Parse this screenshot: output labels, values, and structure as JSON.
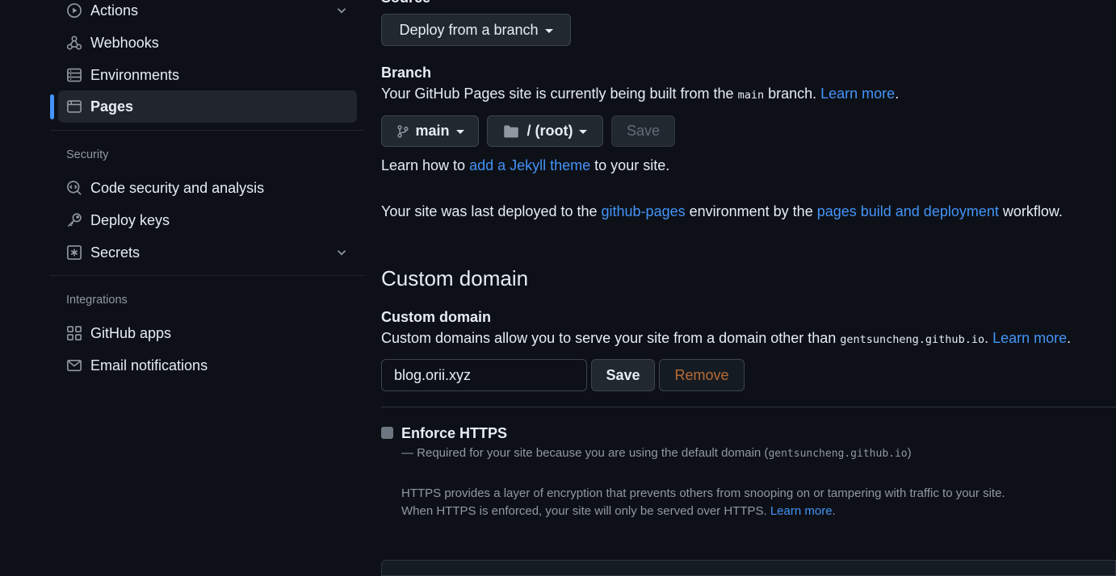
{
  "sidebar": {
    "items_top": [
      {
        "label": "Actions",
        "icon": "play-icon",
        "expandable": true
      },
      {
        "label": "Webhooks",
        "icon": "webhook-icon",
        "expandable": false
      },
      {
        "label": "Environments",
        "icon": "server-icon",
        "expandable": false
      },
      {
        "label": "Pages",
        "icon": "browser-icon",
        "expandable": false,
        "active": true
      }
    ],
    "security_heading": "Security",
    "security_items": [
      {
        "label": "Code security and analysis",
        "icon": "codescan-icon"
      },
      {
        "label": "Deploy keys",
        "icon": "key-icon"
      },
      {
        "label": "Secrets",
        "icon": "key-asterisk-icon",
        "expandable": true
      }
    ],
    "integrations_heading": "Integrations",
    "integrations_items": [
      {
        "label": "GitHub apps",
        "icon": "apps-icon"
      },
      {
        "label": "Email notifications",
        "icon": "mail-icon"
      }
    ]
  },
  "source": {
    "heading": "Source",
    "dropdown_label": "Deploy from a branch"
  },
  "branch": {
    "heading": "Branch",
    "desc_prefix": "Your GitHub Pages site is currently being built from the ",
    "desc_code": "main",
    "desc_suffix": " branch. ",
    "learn_more": "Learn more",
    "period": ".",
    "branch_button": "main",
    "folder_button": "/ (root)",
    "save_button": "Save"
  },
  "jekyll": {
    "prefix": "Learn how to ",
    "link": "add a Jekyll theme",
    "suffix": " to your site."
  },
  "deploy_info": {
    "prefix": "Your site was last deployed to the ",
    "env_link": "github-pages",
    "middle": " environment by the ",
    "workflow_link": "pages build and deployment",
    "suffix": " workflow."
  },
  "custom_domain": {
    "section_title": "Custom domain",
    "label": "Custom domain",
    "desc_prefix": "Custom domains allow you to serve your site from a domain other than ",
    "desc_code": "gentsuncheng.github.io",
    "desc_period": ".",
    "learn_more": "Learn more",
    "period": ".",
    "input_value": "blog.orii.xyz",
    "save_button": "Save",
    "remove_button": "Remove"
  },
  "https": {
    "label": "Enforce HTTPS",
    "required_prefix": "— Required for your site because you are using the default domain (",
    "required_code": "gentsuncheng.github.io",
    "required_suffix": ")",
    "info_line1": "HTTPS provides a layer of encryption that prevents others from snooping on or tampering with traffic to your site.",
    "info_line2_prefix": "When HTTPS is enforced, your site will only be served over HTTPS. ",
    "learn_more": "Learn more",
    "period": ".",
    "checked": true
  },
  "colors": {
    "background": "#0d1117",
    "link": "#4493f8",
    "active_indicator": "#4493f8",
    "remove_text": "#b86b32"
  }
}
